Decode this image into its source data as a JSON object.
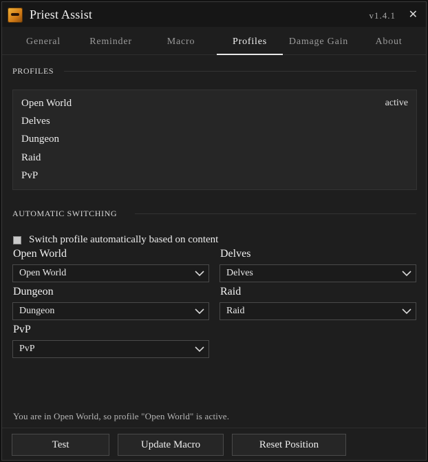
{
  "window": {
    "title": "Priest Assist",
    "version": "v1.4.1",
    "close_glyph": "✕",
    "app_icon": "priest-portrait-icon"
  },
  "tabs": [
    {
      "label": "General",
      "active": false
    },
    {
      "label": "Reminder",
      "active": false
    },
    {
      "label": "Macro",
      "active": false
    },
    {
      "label": "Profiles",
      "active": true
    },
    {
      "label": "Damage Gain",
      "active": false
    },
    {
      "label": "About",
      "active": false
    }
  ],
  "profiles": {
    "heading": "PROFILES",
    "items": [
      {
        "name": "Open World",
        "state": "active"
      },
      {
        "name": "Delves",
        "state": ""
      },
      {
        "name": "Dungeon",
        "state": ""
      },
      {
        "name": "Raid",
        "state": ""
      },
      {
        "name": "PvP",
        "state": ""
      }
    ]
  },
  "auto_switch": {
    "heading": "AUTOMATIC SWITCHING",
    "checkbox_label": "Switch profile automatically based on content",
    "checked": false,
    "fields": {
      "open_world": {
        "label": "Open World",
        "value": "Open World"
      },
      "delves": {
        "label": "Delves",
        "value": "Delves"
      },
      "dungeon": {
        "label": "Dungeon",
        "value": "Dungeon"
      },
      "raid": {
        "label": "Raid",
        "value": "Raid"
      },
      "pvp": {
        "label": "PvP",
        "value": "PvP"
      }
    }
  },
  "status": {
    "text": "You are in Open World, so profile \"Open World\" is active."
  },
  "footer": {
    "test_label": "Test",
    "update_macro_label": "Update Macro",
    "reset_position_label": "Reset Position"
  },
  "colors": {
    "background": "#1e1e1e",
    "panel": "#262626",
    "text": "#ececec",
    "muted": "#9a9a9a"
  }
}
